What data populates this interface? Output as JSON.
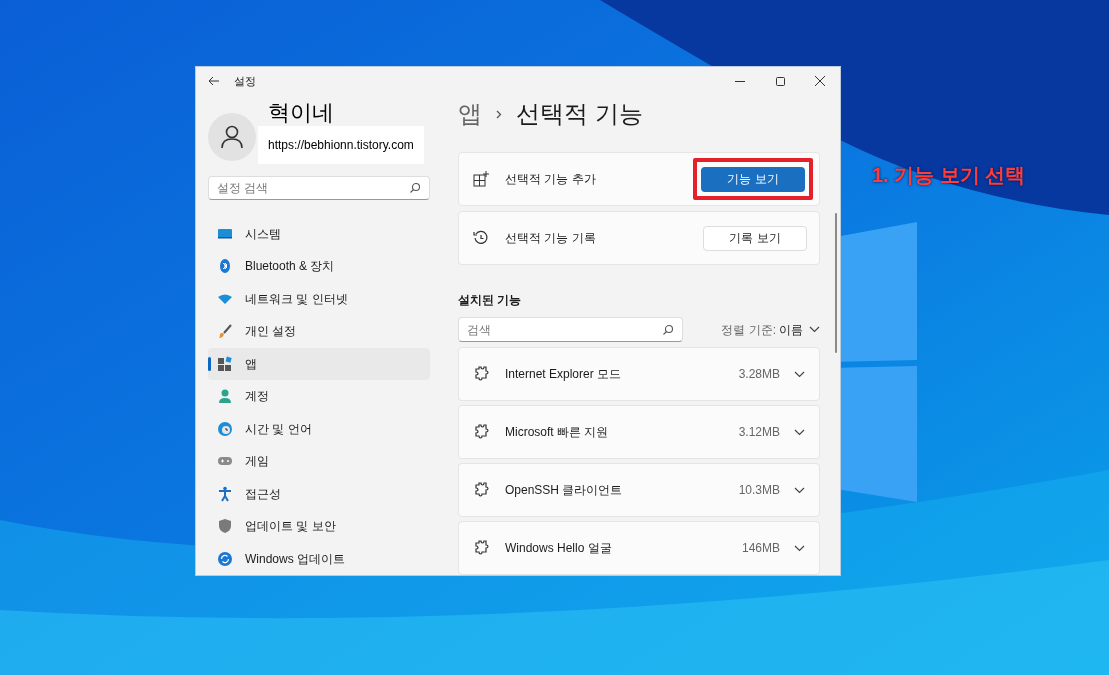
{
  "window": {
    "title": "설정"
  },
  "profile": {
    "name": "혁이네",
    "url": "https://bebhionn.tistory.com"
  },
  "sidebar": {
    "search": {
      "placeholder": "설정 검색"
    },
    "items": [
      {
        "label": "시스템",
        "selected": false
      },
      {
        "label": "Bluetooth & 장치",
        "selected": false
      },
      {
        "label": "네트워크 및 인터넷",
        "selected": false
      },
      {
        "label": "개인 설정",
        "selected": false
      },
      {
        "label": "앱",
        "selected": true
      },
      {
        "label": "계정",
        "selected": false
      },
      {
        "label": "시간 및 언어",
        "selected": false
      },
      {
        "label": "게임",
        "selected": false
      },
      {
        "label": "접근성",
        "selected": false
      },
      {
        "label": "업데이트 및 보안",
        "selected": false
      },
      {
        "label": "Windows 업데이트",
        "selected": false
      }
    ]
  },
  "breadcrumb": {
    "parent": "앱",
    "current": "선택적 기능"
  },
  "actions": [
    {
      "kind": "add",
      "label": "선택적 기능 추가",
      "button": "기능 보기",
      "primary": true,
      "highlighted": true
    },
    {
      "kind": "history",
      "label": "선택적 기능 기록",
      "button": "기록 보기",
      "primary": false,
      "highlighted": false
    }
  ],
  "installed": {
    "heading": "설치된 기능",
    "search": {
      "placeholder": "검색"
    },
    "sort": {
      "label": "정렬 기준:",
      "value": "이름"
    },
    "items": [
      {
        "name": "Internet Explorer 모드",
        "size": "3.28MB",
        "expanded": false
      },
      {
        "name": "Microsoft 빠른 지원",
        "size": "3.12MB",
        "expanded": false
      },
      {
        "name": "OpenSSH 클라이언트",
        "size": "10.3MB",
        "expanded": false
      },
      {
        "name": "Windows Hello 얼굴",
        "size": "146MB",
        "expanded": false
      }
    ]
  },
  "annotation": "1. 기능 보기 선택"
}
